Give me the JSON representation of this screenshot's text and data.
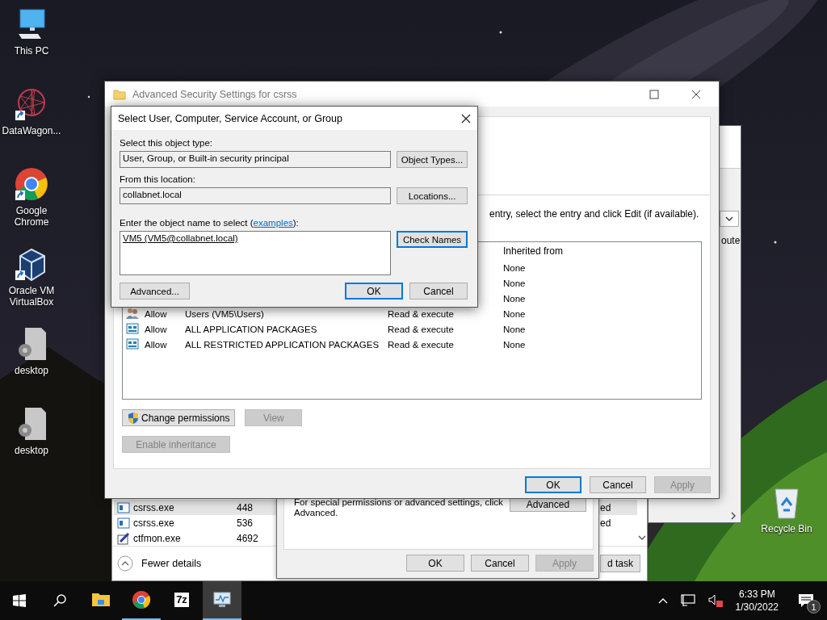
{
  "desktop_icons": [
    {
      "label": "This PC",
      "kind": "pc",
      "shortcut": false
    },
    {
      "label": "DataWagon...",
      "kind": "star",
      "shortcut": true
    },
    {
      "label": "Google Chrome",
      "kind": "chrome",
      "shortcut": true
    },
    {
      "label": "Oracle VM VirtualBox",
      "kind": "virtualbox",
      "shortcut": true
    },
    {
      "label": "desktop",
      "kind": "file",
      "shortcut": false
    },
    {
      "label": "desktop",
      "kind": "file",
      "shortcut": false
    }
  ],
  "recycle_bin": {
    "label": "Recycle Bin"
  },
  "task_manager": {
    "rows": [
      {
        "name": "csrss.exe",
        "pid": "448",
        "status": "ed",
        "selected": true,
        "kind": "app"
      },
      {
        "name": "csrss.exe",
        "pid": "536",
        "status": "ed",
        "selected": false,
        "kind": "app"
      },
      {
        "name": "ctfmon.exe",
        "pid": "4692",
        "selected": false,
        "kind": "pen"
      }
    ],
    "fewer_details": "Fewer details",
    "end_task_button": "d task"
  },
  "permissions_dialog": {
    "note": "For special permissions or advanced settings, click Advanced.",
    "advanced_button": "Advanced",
    "buttons": [
      {
        "label": "OK",
        "disabled": false,
        "default": false
      },
      {
        "label": "Cancel",
        "disabled": false,
        "default": false
      },
      {
        "label": "Apply",
        "disabled": true,
        "default": false
      }
    ]
  },
  "background_window": {
    "text": "oute"
  },
  "security_window": {
    "title": "Advanced Security Settings for csrss",
    "instruction": "entry, select the entry and click Edit (if available).",
    "list_header": "Inherited from",
    "entries": [
      {
        "inherited_from": "None"
      },
      {
        "inherited_from": "None"
      },
      {
        "inherited_from": "None"
      },
      {
        "kind": "users",
        "type": "Allow",
        "principal": "Users (VM5\\Users)",
        "access": "Read & execute",
        "inherited_from": "None"
      },
      {
        "kind": "package",
        "type": "Allow",
        "principal": "ALL APPLICATION PACKAGES",
        "access": "Read & execute",
        "inherited_from": "None"
      },
      {
        "kind": "package",
        "type": "Allow",
        "principal": "ALL RESTRICTED APPLICATION PACKAGES",
        "access": "Read & execute",
        "inherited_from": "None"
      }
    ],
    "change_permissions": "Change permissions",
    "view_button": {
      "label": "View",
      "disabled": true
    },
    "inheritance_button": {
      "label": "Enable inheritance",
      "disabled": true
    },
    "buttons": [
      {
        "label": "OK",
        "disabled": false,
        "default": true
      },
      {
        "label": "Cancel",
        "disabled": false,
        "default": false
      },
      {
        "label": "Apply",
        "disabled": true,
        "default": false
      }
    ]
  },
  "select_dialog": {
    "title": "Select User, Computer, Service Account, or Group",
    "object_type_label": "Select this object type:",
    "object_type": "User, Group, or Built-in security principal",
    "object_types_button": "Object Types...",
    "location_label": "From this location:",
    "location": "collabnet.local",
    "locations_button": "Locations...",
    "name_label_before": "Enter the object name to select (",
    "examples_link": "examples",
    "name_label_after": "):",
    "name_value": "VM5 (VM5@collabnet.local)",
    "check_names_button": "Check Names",
    "advanced_button": "Advanced...",
    "buttons": [
      {
        "label": "OK",
        "disabled": false,
        "default": true
      },
      {
        "label": "Cancel",
        "disabled": false,
        "default": false
      }
    ]
  },
  "taskbar": {
    "apps": [
      {
        "kind": "explorer",
        "running": false,
        "active": false
      },
      {
        "kind": "chrome",
        "running": true,
        "active": false
      },
      {
        "kind": "archive",
        "label": "7z",
        "running": false,
        "active": false
      },
      {
        "kind": "taskmgr",
        "running": true,
        "active": true
      }
    ],
    "time": "6:33 PM",
    "date": "1/30/2022",
    "notification_count": "1",
    "volume_muted": true
  }
}
